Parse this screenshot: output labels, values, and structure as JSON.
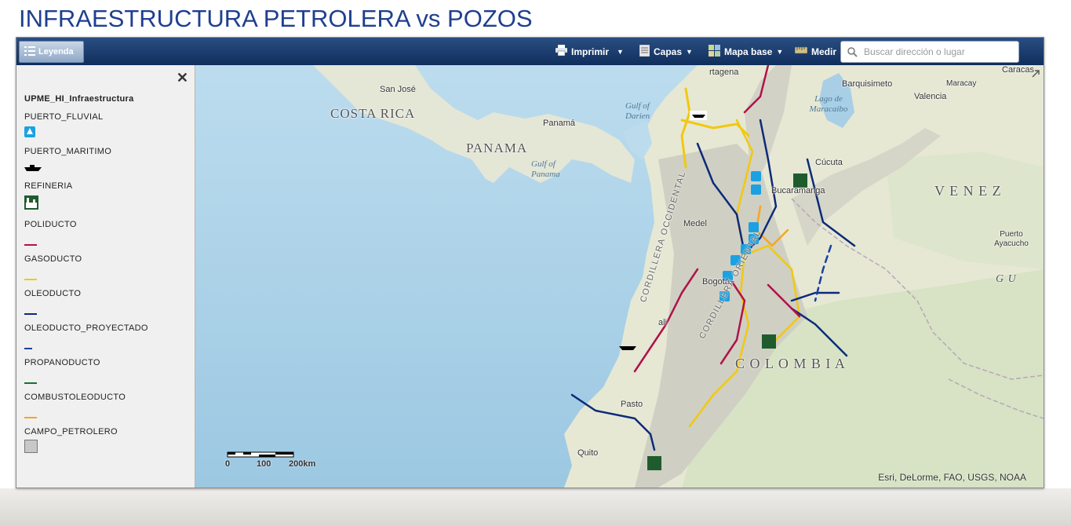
{
  "page": {
    "title": "INFRAESTRUCTURA PETROLERA vs POZOS"
  },
  "toolbar": {
    "legend_label": "Leyenda",
    "print_label": "Imprimir",
    "layers_label": "Capas",
    "basemap_label": "Mapa base",
    "measure_label": "Medir",
    "search_placeholder": "Buscar dirección o lugar"
  },
  "legend": {
    "close_glyph": "✕",
    "layer_title": "UPME_HI_Infraestructura",
    "items": [
      {
        "label": "PUERTO_FLUVIAL",
        "symbol": "river-port-icon",
        "color": "#1ba1e2"
      },
      {
        "label": "PUERTO_MARITIMO",
        "symbol": "ship-icon",
        "color": "#000000"
      },
      {
        "label": "REFINERIA",
        "symbol": "refinery-icon",
        "color": "#1e5c2e"
      },
      {
        "label": "POLIDUCTO",
        "symbol": "line",
        "color": "#b0124a"
      },
      {
        "label": "GASODUCTO",
        "symbol": "line",
        "color": "#f2c80f"
      },
      {
        "label": "OLEODUCTO",
        "symbol": "line",
        "color": "#0d2a7a"
      },
      {
        "label": "OLEODUCTO_PROYECTADO",
        "symbol": "line",
        "color": "#1a3fa0"
      },
      {
        "label": "PROPANODUCTO",
        "symbol": "line",
        "color": "#1e6b3a"
      },
      {
        "label": "COMBUSTOLEODUCTO",
        "symbol": "line",
        "color": "#f5a623"
      },
      {
        "label": "CAMPO_PETROLERO",
        "symbol": "polygon",
        "color": "#c8c8c8"
      }
    ]
  },
  "map": {
    "labels": {
      "costa_rica": "COSTA RICA",
      "panama": "PANAMA",
      "venezuela": "V E N E Z",
      "colombia": "C O L O M B I A",
      "san_jose": "San José",
      "panama_city": "Panamá",
      "gulf_darien": "Gulf of Darien",
      "gulf_panama": "Gulf of Panama",
      "cartagena": "rtagena",
      "barquisimeto": "Barquisimeto",
      "maracay": "Maracay",
      "caracas": "Caracas",
      "valencia": "Valencia",
      "maracaibo_lake": "Lago de Maracaibo",
      "cucuta": "Cúcuta",
      "bucaramanga": "Bucaramanga",
      "medellin": "Medel",
      "bogota": "Bogotá",
      "cali": "ali",
      "pasto": "Pasto",
      "quito": "Quito",
      "puerto_ayacucho": "Puerto Ayacucho",
      "gu": "G U",
      "cord_occidental": "CORDILLERA OCCIDENTAL",
      "cord_oriental": "CORDILLERA ORIENTAL"
    },
    "scale": {
      "t0": "0",
      "t1": "100",
      "t2": "200km"
    },
    "attribution": "Esri, DeLorme, FAO, USGS, NOAA"
  }
}
